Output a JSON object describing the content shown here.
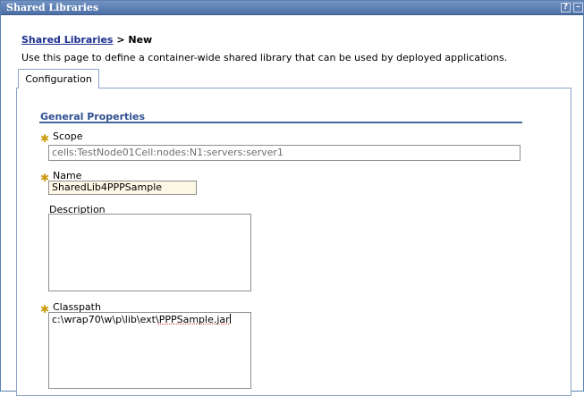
{
  "window": {
    "title": "Shared Libraries",
    "help_glyph": "?",
    "minimize_glyph": "–"
  },
  "breadcrumb": {
    "link": "Shared Libraries",
    "separator": " > ",
    "current": "New"
  },
  "description": "Use this page to define a container-wide shared library that can be used by deployed applications.",
  "tabs": [
    {
      "label": "Configuration"
    }
  ],
  "section": {
    "title": "General Properties"
  },
  "form": {
    "required_glyph": "✱",
    "scope": {
      "label": "Scope",
      "value": "cells:TestNode01Cell:nodes:N1:servers:server1"
    },
    "name": {
      "label": "Name",
      "value": "SharedLib4PPPSample"
    },
    "description": {
      "label": "Description",
      "value": ""
    },
    "classpath": {
      "label": "Classpath",
      "value_prefix": "c:\\wrap70\\w\\p\\lib\\ext\\",
      "value_file": "PPPSample.jar"
    }
  },
  "colors": {
    "titlebar": "#4c6fa5",
    "link": "#1c2f8f",
    "section_title": "#2d4f8f",
    "required_marker": "#c99a0a",
    "name_field_bg": "#fdf8e6"
  }
}
